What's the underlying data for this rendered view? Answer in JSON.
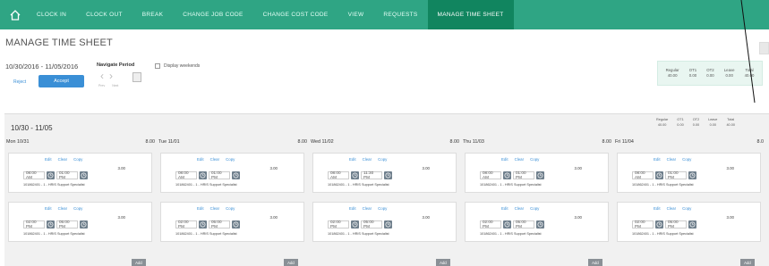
{
  "nav": {
    "items": [
      "CLOCK IN",
      "CLOCK OUT",
      "BREAK",
      "CHANGE JOB CODE",
      "CHANGE COST CODE",
      "VIEW",
      "REQUESTS",
      "MANAGE TIME SHEET"
    ],
    "active_index": 7,
    "color": "#2fa584"
  },
  "page": {
    "title": "MANAGE TIME SHEET",
    "period": "10/30/2016 - 11/05/2016",
    "navigate_label": "Navigate Period",
    "prev_label": "Prev",
    "next_label": "Next",
    "display_weekends_label": "Display weekends",
    "reject_label": "Reject",
    "accept_label": "Accept"
  },
  "totals": {
    "labels": [
      "Regular",
      "OT1",
      "OT2",
      "Leave",
      "Total"
    ],
    "values": [
      "40.00",
      "0.00",
      "0.00",
      "0.00",
      "40.00"
    ]
  },
  "week": {
    "title": "10/30 - 11/05",
    "add_label": "Add",
    "days": [
      {
        "label": "Mon 10/31",
        "hours": "8.00",
        "entries": [
          {
            "edit": "Edit",
            "clear": "Clear",
            "copy": "Copy",
            "hours": "3.00",
            "start": "08:00 AM",
            "end": "01:00 PM",
            "job": "101862401 - 1 - HRIS Support Specialist"
          },
          {
            "edit": "Edit",
            "clear": "Clear",
            "copy": "Copy",
            "hours": "3.00",
            "start": "02:00 PM",
            "end": "05:00 PM",
            "job": "101862401 - 1 - HRIS Support Specialist"
          }
        ]
      },
      {
        "label": "Tue 11/01",
        "hours": "8.00",
        "entries": [
          {
            "edit": "Edit",
            "clear": "Clear",
            "copy": "Copy",
            "hours": "3.00",
            "start": "08:00 AM",
            "end": "01:00 PM",
            "job": "101862401 - 1 - HRIS Support Specialist"
          },
          {
            "edit": "Edit",
            "clear": "Clear",
            "copy": "Copy",
            "hours": "3.00",
            "start": "02:00 PM",
            "end": "05:00 PM",
            "job": "101862401 - 1 - HRIS Support Specialist"
          }
        ]
      },
      {
        "label": "Wed 11/02",
        "hours": "8.00",
        "entries": [
          {
            "edit": "Edit",
            "clear": "Clear",
            "copy": "Copy",
            "hours": "3.00",
            "start": "08:00 AM",
            "end": "11:30 PM",
            "job": "101862401 - 1 - HRIS Support Specialist"
          },
          {
            "edit": "Edit",
            "clear": "Clear",
            "copy": "Copy",
            "hours": "3.00",
            "start": "02:00 PM",
            "end": "05:00 PM",
            "job": "101862401 - 1 - HRIS Support Specialist"
          }
        ]
      },
      {
        "label": "Thu 11/03",
        "hours": "8.00",
        "entries": [
          {
            "edit": "Edit",
            "clear": "Clear",
            "copy": "Copy",
            "hours": "3.00",
            "start": "08:00 AM",
            "end": "01:00 PM",
            "job": "101862401 - 1 - HRIS Support Specialist"
          },
          {
            "edit": "Edit",
            "clear": "Clear",
            "copy": "Copy",
            "hours": "3.00",
            "start": "02:00 PM",
            "end": "05:00 PM",
            "job": "101862401 - 1 - HRIS Support Specialist"
          }
        ]
      },
      {
        "label": "Fri 11/04",
        "hours": "8.0",
        "entries": [
          {
            "edit": "Edit",
            "clear": "Clear",
            "copy": "Copy",
            "hours": "3.00",
            "start": "08:00 AM",
            "end": "01:00 PM",
            "job": "101862401 - 1 - HRIS Support Specialist"
          },
          {
            "edit": "Edit",
            "clear": "Clear",
            "copy": "Copy",
            "hours": "3.00",
            "start": "02:00 PM",
            "end": "05:00 PM",
            "job": "101862401 - 1 - HRIS Support Specialist"
          }
        ]
      }
    ]
  }
}
